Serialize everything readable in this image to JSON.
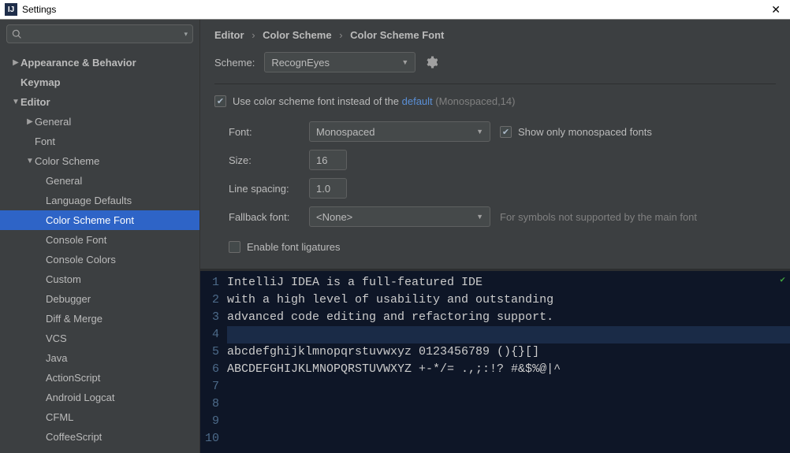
{
  "window": {
    "title": "Settings",
    "app_icon": "IJ"
  },
  "search": {
    "placeholder": ""
  },
  "tree": {
    "items": [
      {
        "label": "Appearance & Behavior",
        "indent": 0,
        "arrow": "▶",
        "bold": true
      },
      {
        "label": "Keymap",
        "indent": 0,
        "arrow": "",
        "bold": true
      },
      {
        "label": "Editor",
        "indent": 0,
        "arrow": "▼",
        "bold": true
      },
      {
        "label": "General",
        "indent": 1,
        "arrow": "▶",
        "bold": false
      },
      {
        "label": "Font",
        "indent": 1,
        "arrow": "",
        "bold": false
      },
      {
        "label": "Color Scheme",
        "indent": 1,
        "arrow": "▼",
        "bold": false
      },
      {
        "label": "General",
        "indent": 2,
        "arrow": "",
        "bold": false
      },
      {
        "label": "Language Defaults",
        "indent": 2,
        "arrow": "",
        "bold": false
      },
      {
        "label": "Color Scheme Font",
        "indent": 2,
        "arrow": "",
        "bold": false,
        "selected": true
      },
      {
        "label": "Console Font",
        "indent": 2,
        "arrow": "",
        "bold": false
      },
      {
        "label": "Console Colors",
        "indent": 2,
        "arrow": "",
        "bold": false
      },
      {
        "label": "Custom",
        "indent": 2,
        "arrow": "",
        "bold": false
      },
      {
        "label": "Debugger",
        "indent": 2,
        "arrow": "",
        "bold": false
      },
      {
        "label": "Diff & Merge",
        "indent": 2,
        "arrow": "",
        "bold": false
      },
      {
        "label": "VCS",
        "indent": 2,
        "arrow": "",
        "bold": false
      },
      {
        "label": "Java",
        "indent": 2,
        "arrow": "",
        "bold": false
      },
      {
        "label": "ActionScript",
        "indent": 2,
        "arrow": "",
        "bold": false
      },
      {
        "label": "Android Logcat",
        "indent": 2,
        "arrow": "",
        "bold": false
      },
      {
        "label": "CFML",
        "indent": 2,
        "arrow": "",
        "bold": false
      },
      {
        "label": "CoffeeScript",
        "indent": 2,
        "arrow": "",
        "bold": false
      }
    ]
  },
  "breadcrumb": {
    "a": "Editor",
    "b": "Color Scheme",
    "c": "Color Scheme Font"
  },
  "scheme": {
    "label": "Scheme:",
    "value": "RecognEyes"
  },
  "use_scheme_font": {
    "prefix": "Use color scheme font instead of the ",
    "link": "default",
    "suffix": "(Monospaced,14)"
  },
  "form": {
    "font_label": "Font:",
    "font_value": "Monospaced",
    "mono_only": "Show only monospaced fonts",
    "size_label": "Size:",
    "size_value": "16",
    "linesp_label": "Line spacing:",
    "linesp_value": "1.0",
    "fallback_label": "Fallback font:",
    "fallback_value": "<None>",
    "fallback_hint": "For symbols not supported by the main font",
    "ligatures": "Enable font ligatures"
  },
  "preview": {
    "lines": [
      "IntelliJ IDEA is a full-featured IDE",
      "with a high level of usability and outstanding",
      "advanced code editing and refactoring support.",
      "",
      "abcdefghijklmnopqrstuvwxyz 0123456789 (){}[]",
      "ABCDEFGHIJKLMNOPQRSTUVWXYZ +-*/= .,;:!? #&$%@|^",
      "",
      "",
      "",
      ""
    ],
    "highlight_line": 4
  }
}
